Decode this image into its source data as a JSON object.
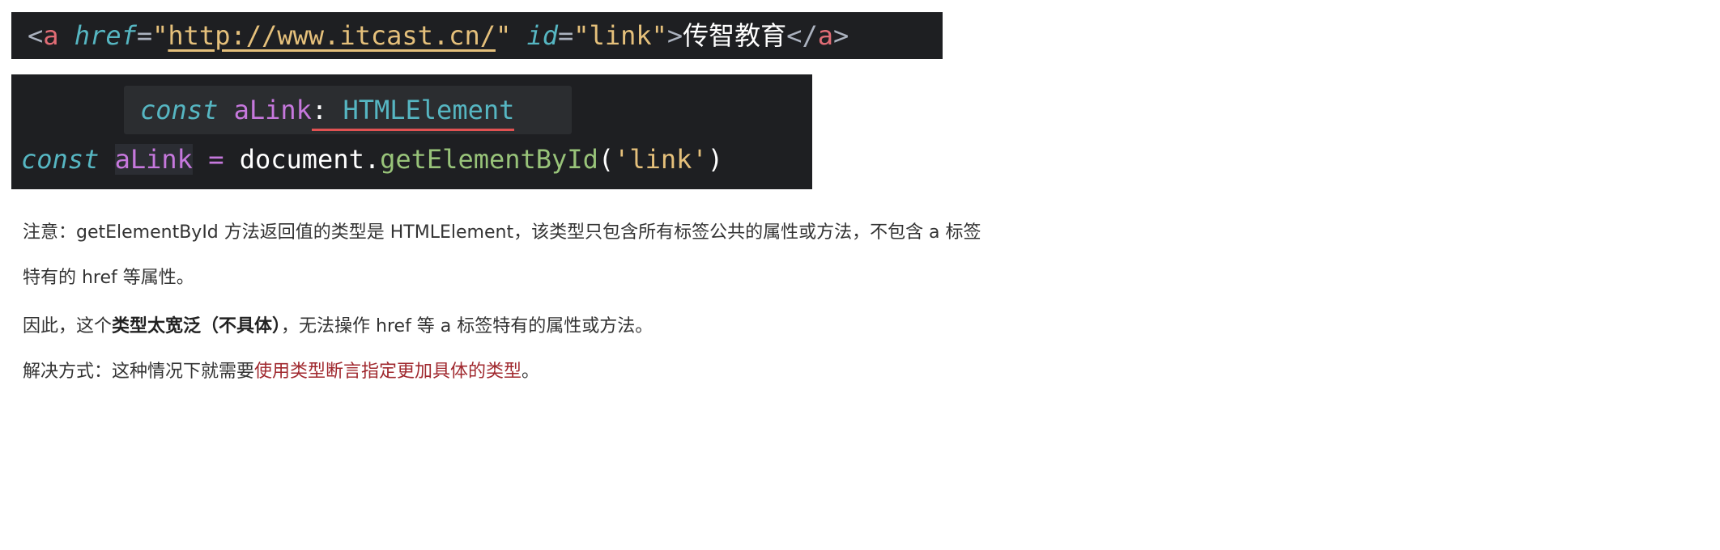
{
  "html_code": {
    "lt": "<",
    "tag": "a",
    "href_attr": "href",
    "eq1": "=",
    "q1": "\"",
    "href_value": "http://www.itcast.cn/",
    "q2": "\"",
    "id_attr": "id",
    "eq2": "=",
    "id_value": "\"link\"",
    "gt": ">",
    "link_text": "传智教育",
    "close_lt": "</",
    "close_tag": "a",
    "close_gt": ">"
  },
  "hover": {
    "keyword": "const",
    "var_name": "aLink",
    "colon": ":",
    "type_name": "HTMLElement"
  },
  "ts_code": {
    "keyword": "const",
    "var_name": "aLink",
    "op": "=",
    "object": "document",
    "dot": ".",
    "method": "getElementById",
    "paren_open": "(",
    "arg": "'link'",
    "paren_close": ")"
  },
  "paragraphs": {
    "p1": "注意：getElementById 方法返回值的类型是 HTMLElement，该类型只包含所有标签公共的属性或方法，不包含 a 标签",
    "p2": "特有的 href 等属性。",
    "p3_a": "因此，这个",
    "p3_bold": "类型太宽泛（不具体）",
    "p3_b": "，无法操作 href 等 a 标签特有的属性或方法。",
    "p4_a": "解决方式：这种情况下就需要",
    "p4_red": "使用类型断言指定更加具体的类型",
    "p4_b": "。"
  }
}
